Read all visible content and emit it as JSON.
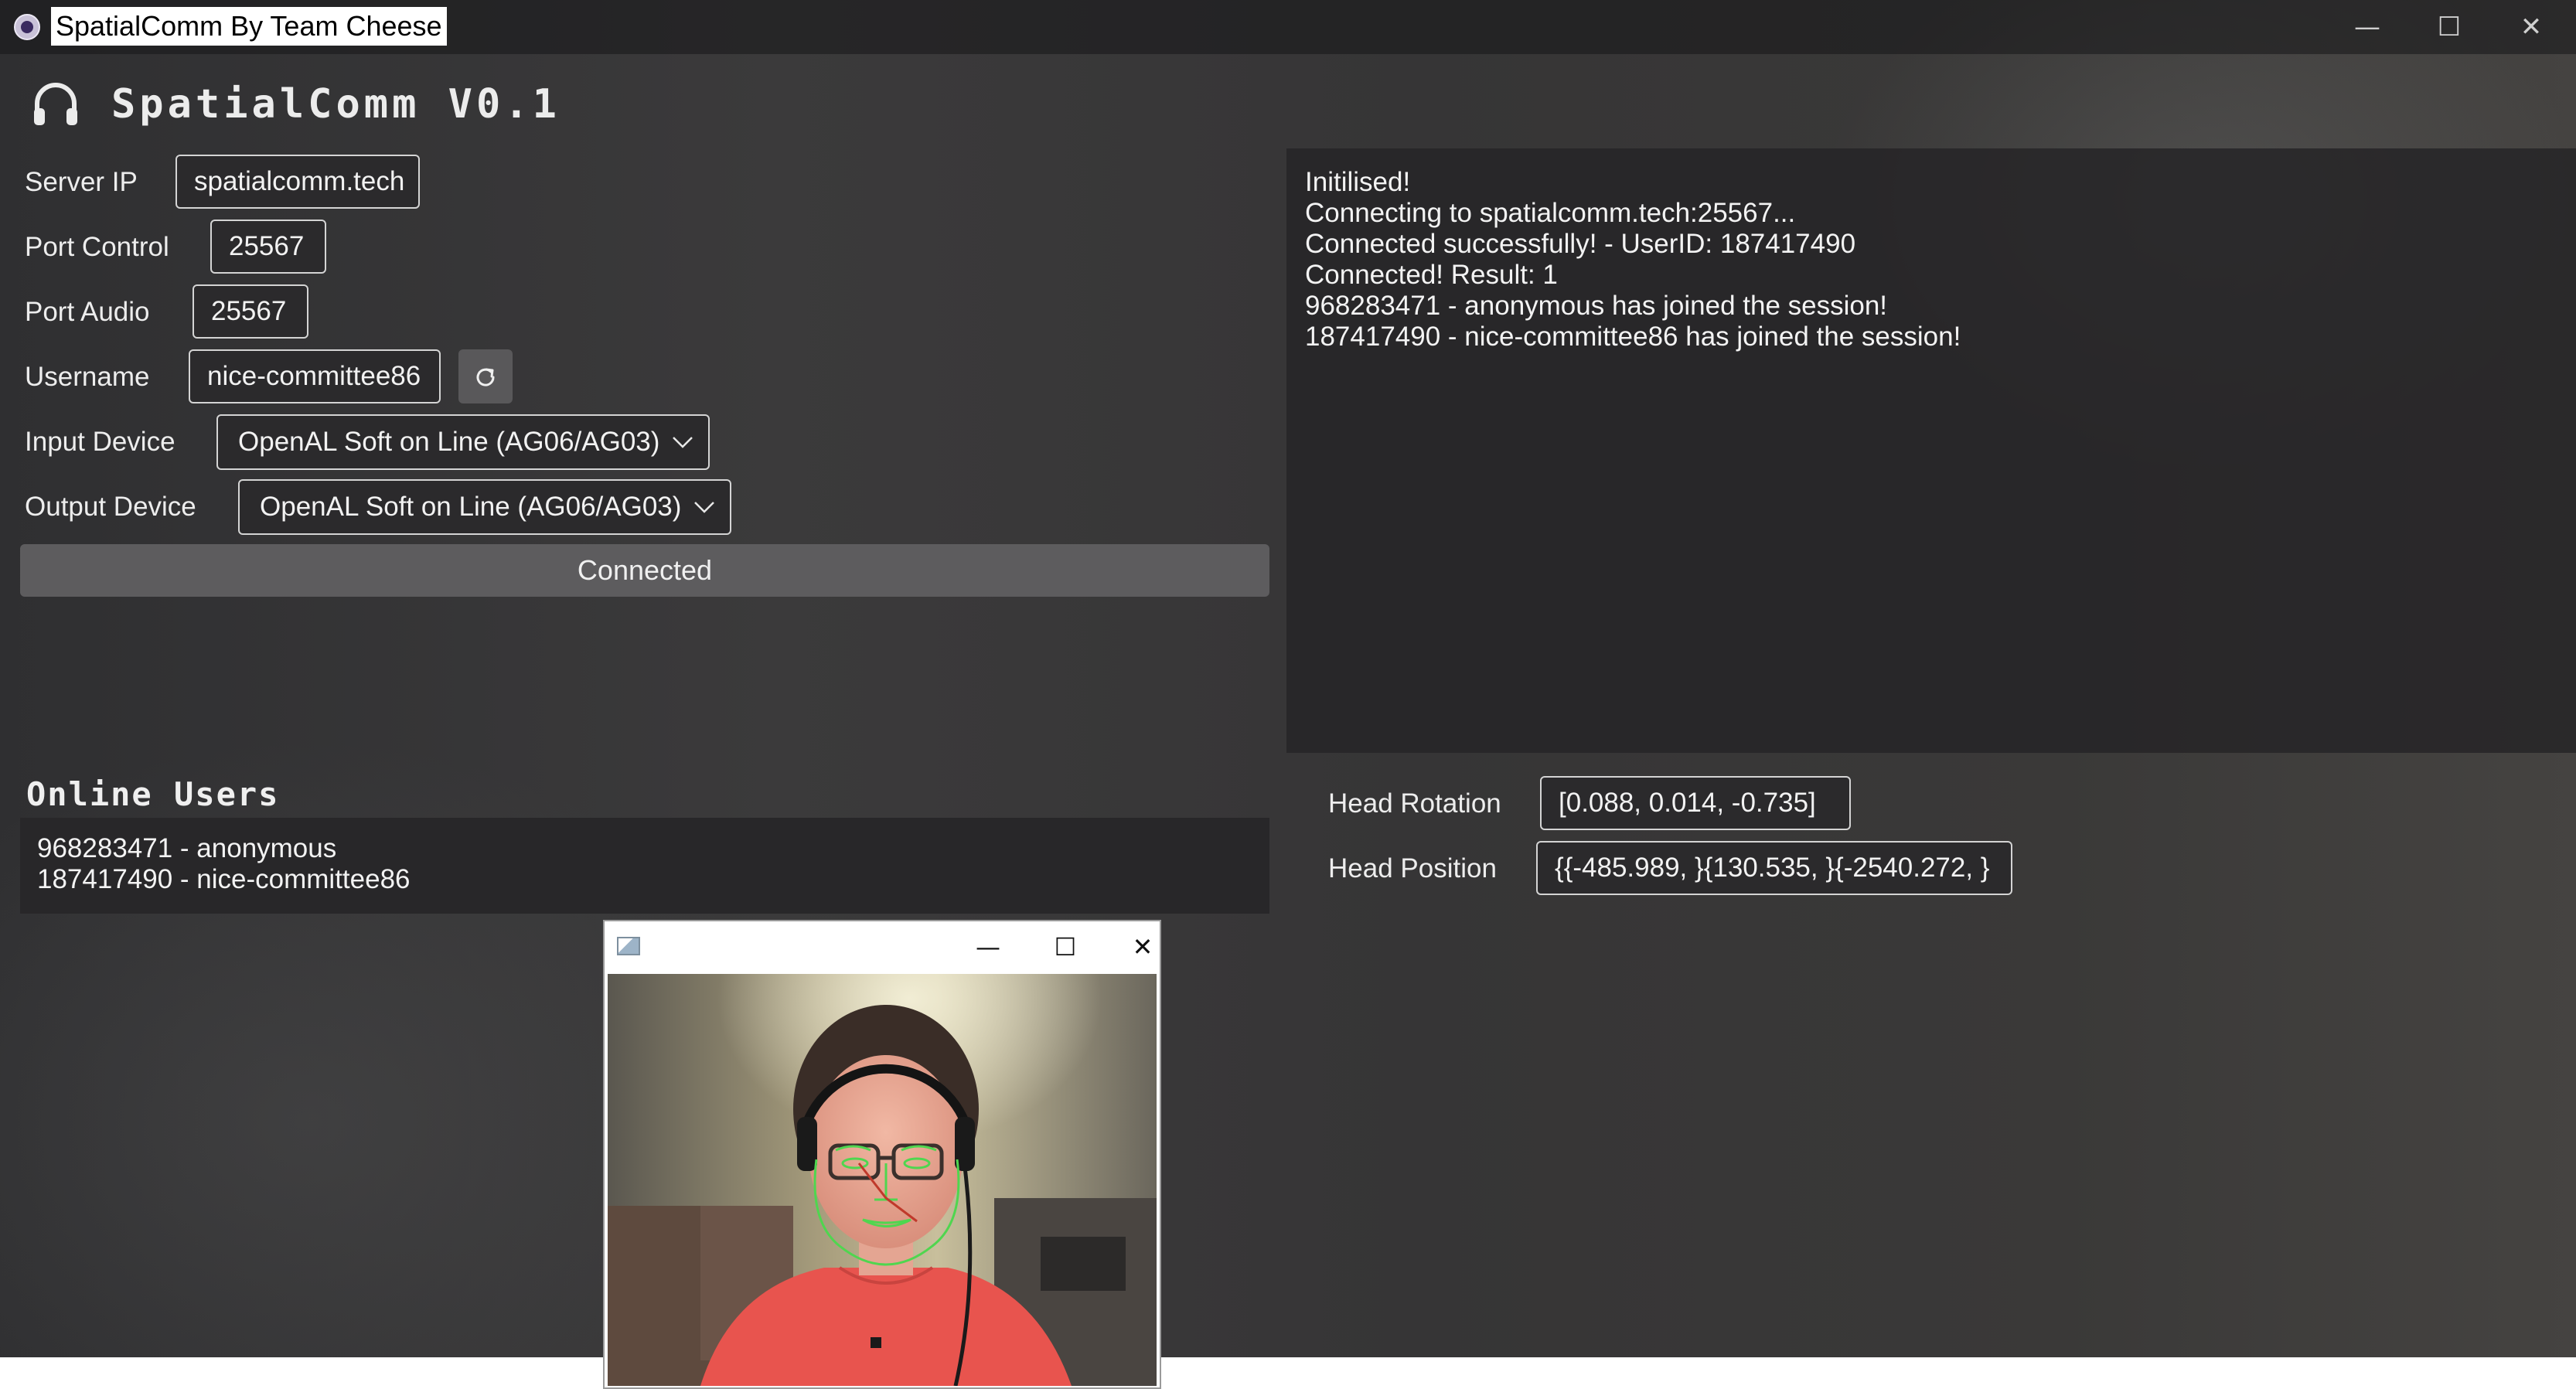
{
  "window": {
    "title": "SpatialComm By Team Cheese",
    "minimize_icon": "minimize-icon",
    "maximize_icon": "maximize-icon",
    "close_icon": "close-icon",
    "minimize_glyph": "—",
    "maximize_glyph": "☐",
    "close_glyph": "✕"
  },
  "header": {
    "icon": "headphones-icon",
    "title": "SpatialComm V0.1"
  },
  "form": {
    "server_ip": {
      "label": "Server IP",
      "value": "spatialcomm.tech"
    },
    "port_control": {
      "label": "Port Control",
      "value": "25567"
    },
    "port_audio": {
      "label": "Port Audio",
      "value": "25567"
    },
    "username": {
      "label": "Username",
      "value": "nice-committee86",
      "refresh_icon": "refresh-icon"
    },
    "input_device": {
      "label": "Input Device",
      "value": "OpenAL Soft on Line (AG06/AG03)"
    },
    "output_device": {
      "label": "Output Device",
      "value": "OpenAL Soft on Line (AG06/AG03)"
    },
    "connect_button": "Connected"
  },
  "log": {
    "lines": [
      "Initilised!",
      "Connecting to spatialcomm.tech:25567...",
      "Connected successfully! - UserID: 187417490",
      "Connected! Result: 1",
      "968283471 - anonymous has joined the session!",
      "187417490 - nice-committee86 has joined the session!"
    ]
  },
  "online_users": {
    "title": "Online Users",
    "users": [
      "968283471 - anonymous",
      "187417490 - nice-committee86"
    ]
  },
  "head_tracking": {
    "rotation": {
      "label": "Head Rotation",
      "value": "[0.088,  0.014,  -0.735]"
    },
    "position": {
      "label": "Head Position",
      "value": "{{-485.989, }{130.535, }{-2540.272, }"
    }
  },
  "camera_window": {
    "icon": "app-window-icon",
    "minimize_glyph": "—",
    "maximize_glyph": "☐",
    "close_glyph": "✕"
  },
  "colors": {
    "face_landmarks": "#4fd64f",
    "pose_axis": "#c0392b",
    "shirt": "#e8544e"
  }
}
